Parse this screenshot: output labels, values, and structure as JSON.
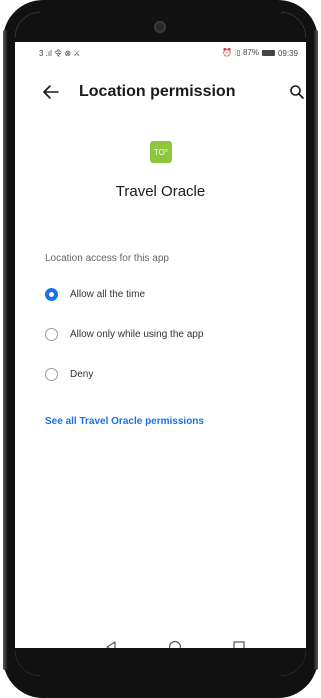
{
  "status_bar": {
    "left_text": "3 .ıl 令 ⊗ ⚔",
    "right_text": "⏰ ⫶▯ 87%",
    "time": "09:39"
  },
  "app_bar": {
    "title": "Location permission",
    "back_icon": "arrow-left-icon",
    "search_icon": "search-icon"
  },
  "app": {
    "icon_text": "TO°",
    "name": "Travel Oracle",
    "icon_color": "#8dc63f"
  },
  "section_label": "Location access for this app",
  "options": [
    {
      "label": "Allow all the time",
      "selected": true
    },
    {
      "label": "Allow only while using the app",
      "selected": false
    },
    {
      "label": "Deny",
      "selected": false
    }
  ],
  "permissions_link": "See all Travel Oracle permissions",
  "accent_color": "#1a73e8",
  "nav": {
    "back": "triangle-back-icon",
    "home": "circle-home-icon",
    "recents": "square-recents-icon"
  }
}
